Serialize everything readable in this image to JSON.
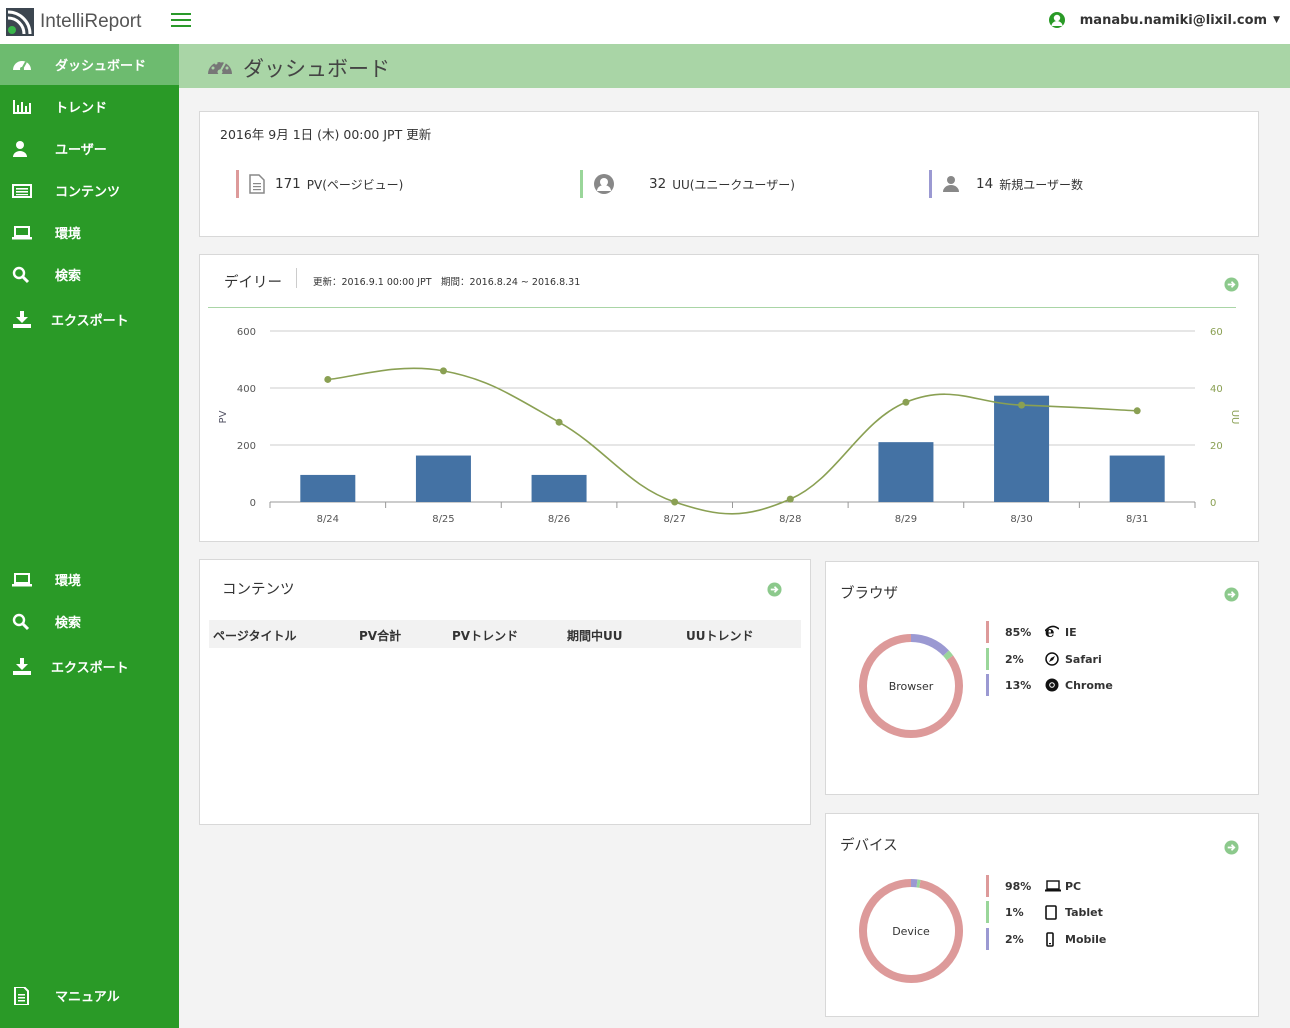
{
  "app": {
    "logo_text": "IntelliReport",
    "user_email": "manabu.namiki@lixil.com"
  },
  "colors": {
    "sidebar": "#2a9a27",
    "sidebar_active": "#6dbb6f",
    "header_band": "#a9d5a6",
    "bar": "#4472a4",
    "line": "#8aa053",
    "pink": "#dd9a9a",
    "green": "#9ad69a",
    "purple": "#9b99d2"
  },
  "sidebar": {
    "items": [
      {
        "label": "ダッシュボード",
        "icon": "dashboard-icon"
      },
      {
        "label": "トレンド",
        "icon": "bar-chart-icon"
      },
      {
        "label": "ユーザー",
        "icon": "user-icon"
      },
      {
        "label": "コンテンツ",
        "icon": "list-icon"
      },
      {
        "label": "環境",
        "icon": "laptop-icon"
      },
      {
        "label": "検索",
        "icon": "search-icon"
      },
      {
        "label": "エクスポート",
        "icon": "download-icon"
      }
    ],
    "lower_items": [
      {
        "label": "環境",
        "icon": "laptop-icon"
      },
      {
        "label": "検索",
        "icon": "search-icon"
      },
      {
        "label": "エクスポート",
        "icon": "download-icon"
      }
    ],
    "manual": {
      "label": "マニュアル",
      "icon": "document-icon"
    }
  },
  "page": {
    "title": "ダッシュボード"
  },
  "summary": {
    "date": "2016年 9月 1日 (木) 00:00 JPT 更新",
    "stats": [
      {
        "value": "171",
        "label": "PV(ページビュー)"
      },
      {
        "value": "32",
        "label": "UU(ユニークユーザー)"
      },
      {
        "value": "14",
        "label": "新規ユーザー数"
      }
    ]
  },
  "daily": {
    "title": "デイリー",
    "meta": "更新：2016.9.1 00:00 JPT　期間：2016.8.24 ~ 2016.8.31"
  },
  "chart_data": {
    "type": "bar",
    "categories": [
      "8/24",
      "8/25",
      "8/26",
      "8/27",
      "8/28",
      "8/29",
      "8/30",
      "8/31"
    ],
    "series": [
      {
        "name": "PV",
        "kind": "bar",
        "axis": "left",
        "values": [
          95,
          163,
          95,
          0,
          0,
          210,
          373,
          163
        ]
      },
      {
        "name": "UU",
        "kind": "line",
        "axis": "right",
        "values": [
          43,
          46,
          28,
          0,
          1,
          35,
          34,
          32
        ]
      }
    ],
    "ylabel": "PV",
    "y2label": "UU",
    "ylim": [
      0,
      600
    ],
    "y2lim": [
      0,
      60
    ],
    "yticks": [
      "0",
      "200",
      "400",
      "600"
    ],
    "y2ticks": [
      "0",
      "20",
      "40",
      "60"
    ]
  },
  "contents": {
    "title": "コンテンツ",
    "columns": [
      "ページタイトル",
      "PV合計",
      "PVトレンド",
      "期間中UU",
      "UUトレンド"
    ]
  },
  "browser": {
    "title": "ブラウザ",
    "center_label": "Browser",
    "items": [
      {
        "pct": "85%",
        "name": "IE",
        "value": 85
      },
      {
        "pct": "2%",
        "name": "Safari",
        "value": 2
      },
      {
        "pct": "13%",
        "name": "Chrome",
        "value": 13
      }
    ]
  },
  "device": {
    "title": "デバイス",
    "center_label": "Device",
    "items": [
      {
        "pct": "98%",
        "name": "PC",
        "value": 98
      },
      {
        "pct": "1%",
        "name": "Tablet",
        "value": 1
      },
      {
        "pct": "2%",
        "name": "Mobile",
        "value": 2
      }
    ]
  }
}
